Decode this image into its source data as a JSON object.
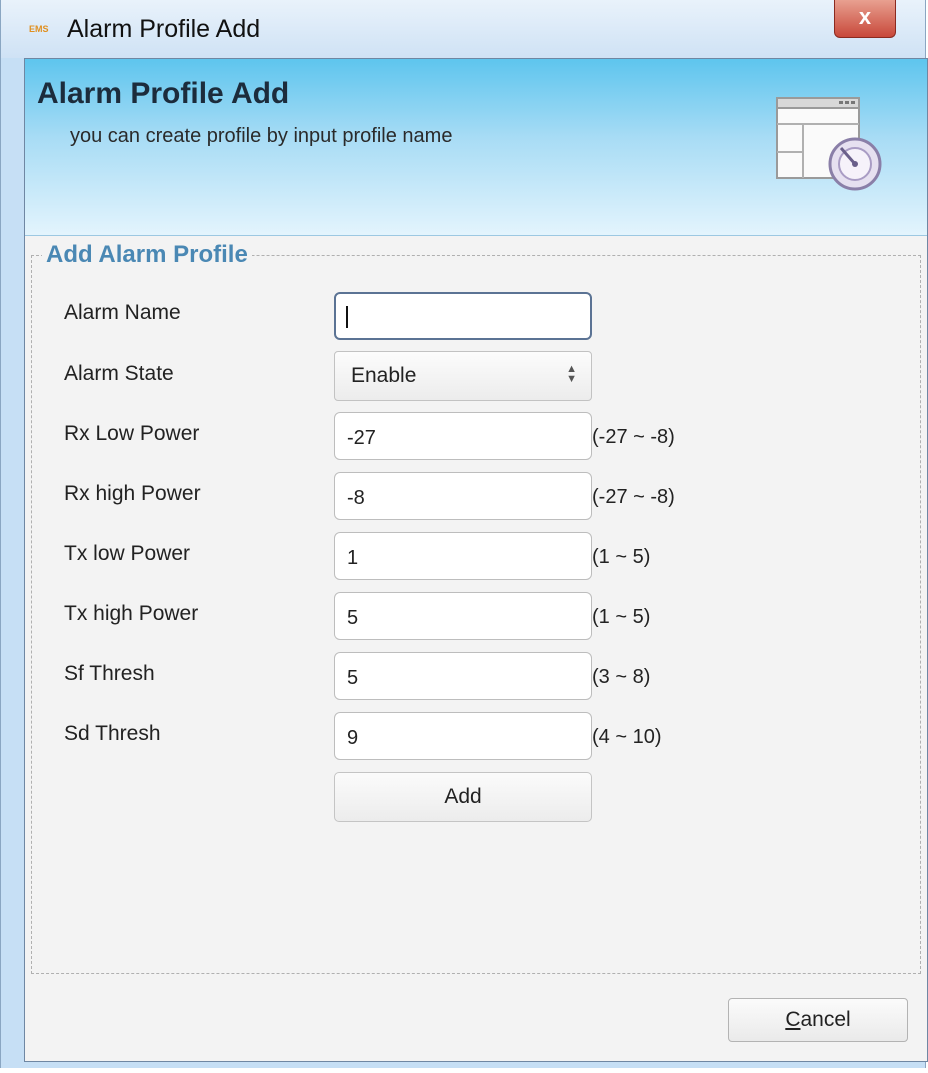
{
  "window": {
    "icon_text": "EMS",
    "title": "Alarm Profile Add",
    "close_symbol": "x"
  },
  "header": {
    "title": "Alarm Profile Add",
    "subtitle": "you can create profile by input profile name",
    "icon": "window-gauge-icon"
  },
  "form": {
    "legend": "Add Alarm Profile",
    "alarm_name": {
      "label": "Alarm Name",
      "value": ""
    },
    "alarm_state": {
      "label": "Alarm State",
      "value": "Enable"
    },
    "rx_low_power": {
      "label": "Rx Low Power",
      "value": "-27",
      "range": "(-27 ~ -8)"
    },
    "rx_high_power": {
      "label": "Rx high Power",
      "value": "-8",
      "range": "(-27 ~ -8)"
    },
    "tx_low_power": {
      "label": "Tx low Power",
      "value": "1",
      "range": "(1 ~ 5)"
    },
    "tx_high_power": {
      "label": "Tx high Power",
      "value": "5",
      "range": "(1 ~ 5)"
    },
    "sf_thresh": {
      "label": "Sf Thresh",
      "value": "5",
      "range": "(3 ~ 8)"
    },
    "sd_thresh": {
      "label": "Sd Thresh",
      "value": "9",
      "range": "(4 ~ 10)"
    },
    "add_label": "Add"
  },
  "footer": {
    "cancel_mnemonic": "C",
    "cancel_rest": "ancel"
  },
  "colors": {
    "header_gradient_top": "#5ec5ee",
    "legend": "#4a88b4",
    "close_button": "#c8483a"
  }
}
